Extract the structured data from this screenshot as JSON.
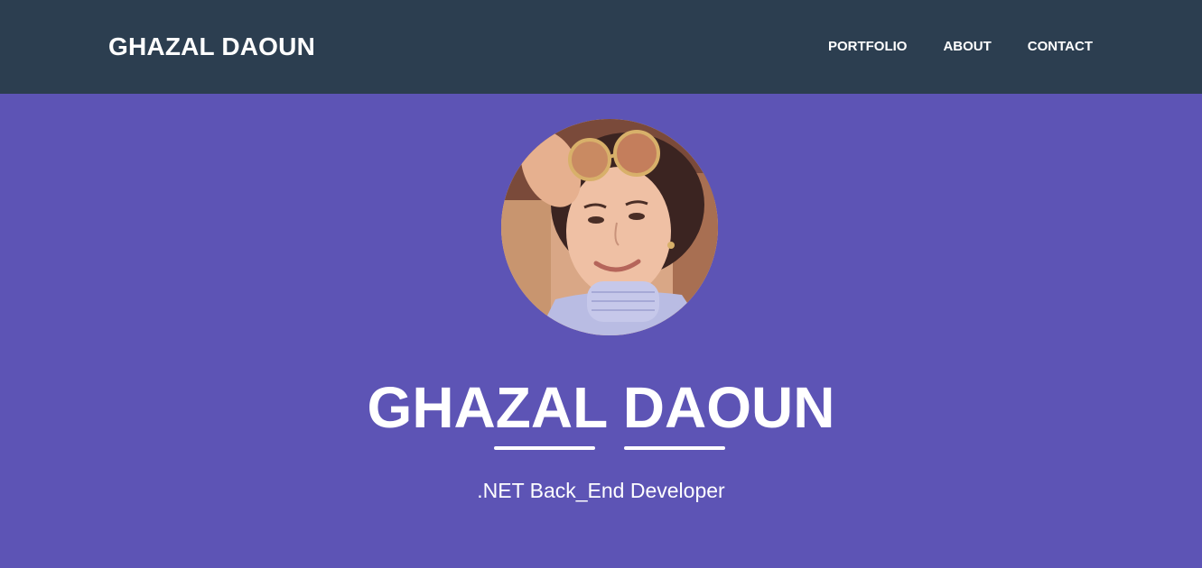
{
  "navbar": {
    "brand": "GHAZAL DAOUN",
    "links": [
      "PORTFOLIO",
      "ABOUT",
      "CONTACT"
    ]
  },
  "hero": {
    "title": "GHAZAL DAOUN",
    "subtitle": ".NET Back_End Developer",
    "avatar_icon": "profile-photo"
  },
  "colors": {
    "navbar_bg": "#2c3e50",
    "hero_bg": "#5d54b5",
    "text": "#ffffff"
  }
}
